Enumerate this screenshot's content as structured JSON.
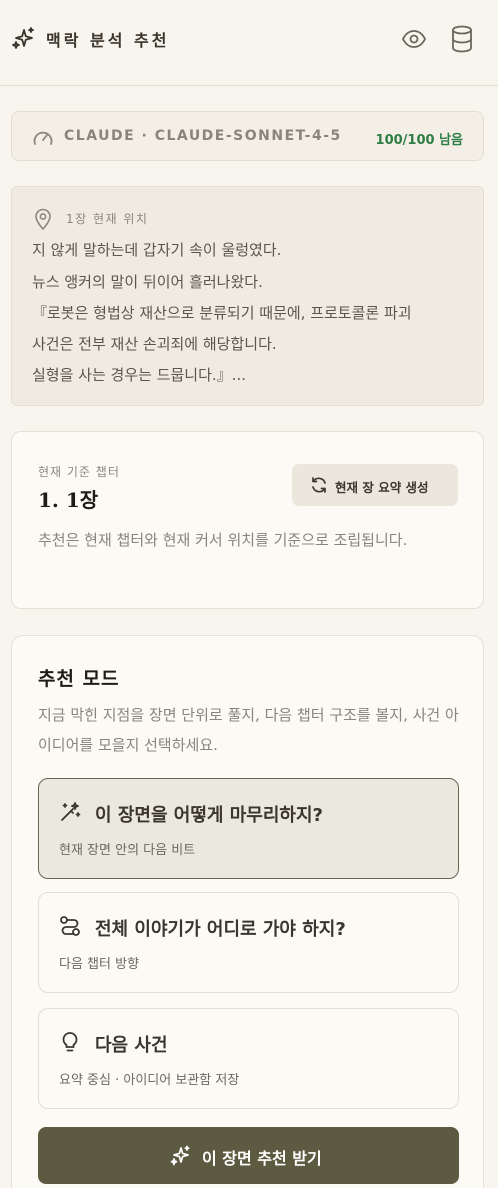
{
  "header": {
    "title": "맥락 분석 추천",
    "logo_icon": "sparkles-icon",
    "actions": [
      {
        "icon": "eye-icon"
      },
      {
        "icon": "database-icon"
      }
    ]
  },
  "model": {
    "icon": "gauge-icon",
    "name": "CLAUDE · CLAUDE-SONNET-4-5",
    "quota": "100/100 남음",
    "quota_color": "#2e7d45"
  },
  "location": {
    "icon": "map-pin-icon",
    "label": "1장 현재 위치",
    "excerpt": [
      "지 않게 말하는데 갑자기 속이 울렁였다.",
      "뉴스 앵커의 말이 뒤이어 흘러나왔다.",
      "『로봇은 형법상 재산으로 분류되기 때문에, 프로토콜론 파괴",
      "사건은 전부 재산 손괴죄에 해당합니다.",
      "실형을 사는 경우는 드뭅니다.』..."
    ]
  },
  "chapter": {
    "label": "현재 기준 챕터",
    "value": "1. 1장",
    "summary_button": "현재 장 요약 생성",
    "summary_icon": "refresh-icon",
    "description": "추천은 현재 챕터와 현재 커서 위치를 기준으로 조립됩니다."
  },
  "mode": {
    "title": "추천 모드",
    "description": "지금 막힌 지점을 장면 단위로 풀지, 다음 챕터 구조를 볼지, 사건 아이디어를 모을지 선택하세요.",
    "options": [
      {
        "icon": "wand-icon",
        "title": "이 장면을 어떻게 마무리하지?",
        "subtitle": "현재 장면 안의 다음 비트",
        "selected": true
      },
      {
        "icon": "route-icon",
        "title": "전체 이야기가 어디로 가야 하지?",
        "subtitle": "다음 챕터 방향",
        "selected": false
      },
      {
        "icon": "lightbulb-icon",
        "title": "다음 사건",
        "subtitle": "요약 중심 · 아이디어 보관함 저장",
        "selected": false
      }
    ],
    "submit_icon": "sparkles-icon",
    "submit_label": "이 장면 추천 받기",
    "submit_color": "#5c5a41"
  }
}
